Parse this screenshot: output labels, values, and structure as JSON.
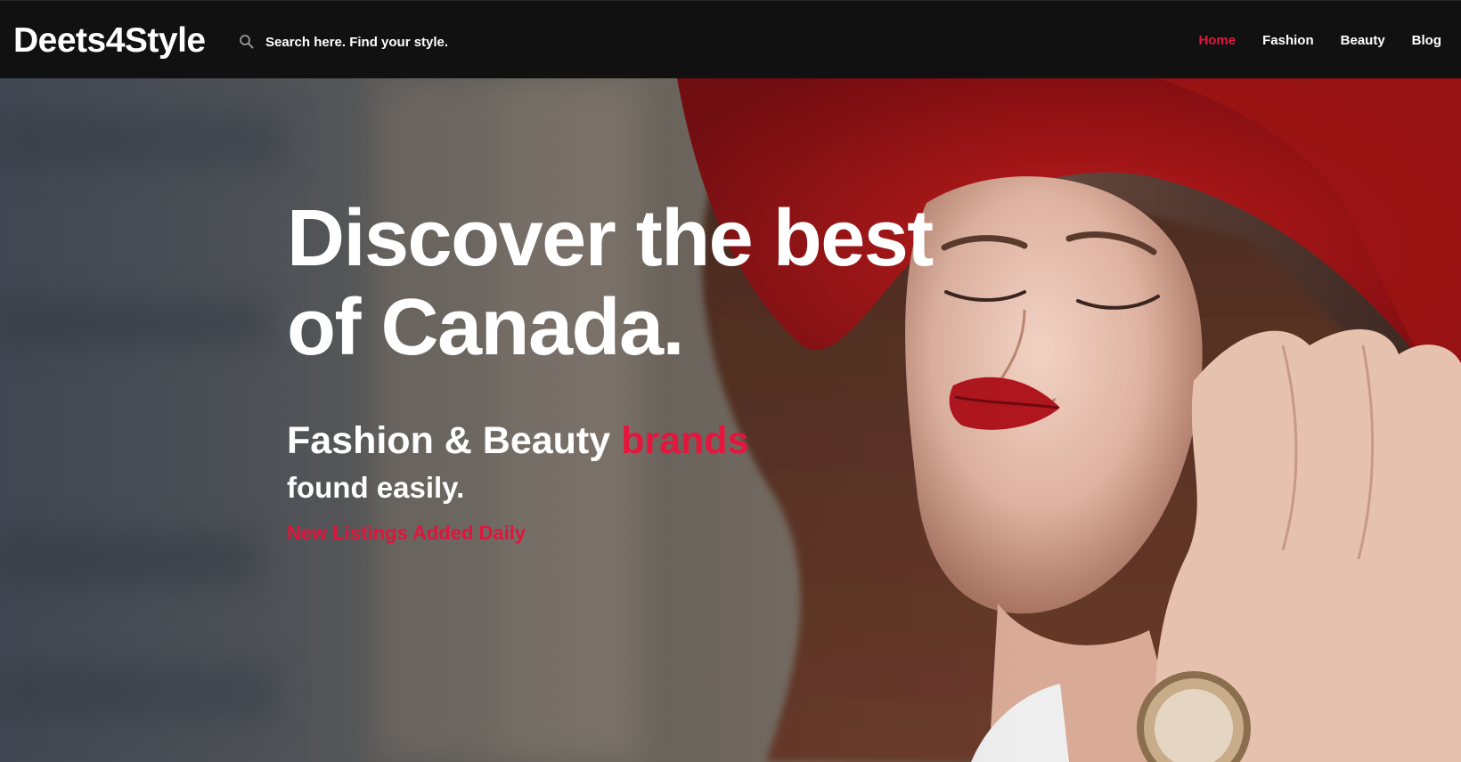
{
  "header": {
    "logo_text": "Deets4Style",
    "search": {
      "placeholder": "Search here. Find your style.",
      "icon": "search-icon"
    },
    "nav": [
      {
        "label": "Home",
        "active": true
      },
      {
        "label": "Fashion",
        "active": false
      },
      {
        "label": "Beauty",
        "active": false
      },
      {
        "label": "Blog",
        "active": false
      }
    ]
  },
  "hero": {
    "headline_line1": "Discover the best",
    "headline_line2": "of Canada.",
    "subline_text": "Fashion & Beauty ",
    "subline_accent": "brands",
    "subline_line2": "found easily.",
    "tagline": "New Listings Added Daily"
  },
  "colors": {
    "header_bg": "#111111",
    "accent": "#e0173f",
    "text": "#ffffff"
  }
}
